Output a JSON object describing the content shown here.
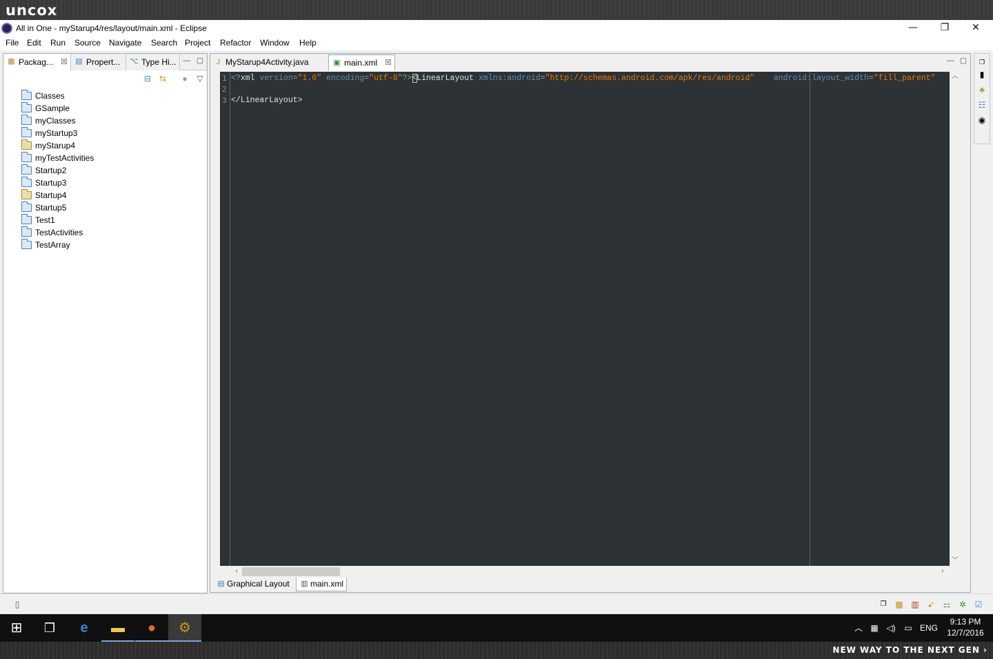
{
  "brand": {
    "logo": "uncox",
    "tagline": "NEW WAY TO THE NEXT GEN ›"
  },
  "window": {
    "title": "All in One - myStarup4/res/layout/main.xml - Eclipse",
    "minimize": "—",
    "restore": "❐",
    "close": "✕"
  },
  "menu": [
    "File",
    "Edit",
    "Run",
    "Source",
    "Navigate",
    "Search",
    "Project",
    "Refactor",
    "Window",
    "Help"
  ],
  "left_tabs": [
    {
      "label": "Packag...",
      "icon": "package-explorer-icon",
      "active": true
    },
    {
      "label": "Propert...",
      "icon": "properties-icon",
      "active": false
    },
    {
      "label": "Type Hi...",
      "icon": "type-hierarchy-icon",
      "active": false
    }
  ],
  "projects": [
    {
      "name": "Classes",
      "type": "java"
    },
    {
      "name": "GSample",
      "type": "java"
    },
    {
      "name": "myClasses",
      "type": "java"
    },
    {
      "name": "myStartup3",
      "type": "java"
    },
    {
      "name": "myStarup4",
      "type": "android"
    },
    {
      "name": "myTestActivities",
      "type": "java"
    },
    {
      "name": "Startup2",
      "type": "java"
    },
    {
      "name": "Startup3",
      "type": "java"
    },
    {
      "name": "Startup4",
      "type": "android"
    },
    {
      "name": "Startup5",
      "type": "java"
    },
    {
      "name": "Test1",
      "type": "java"
    },
    {
      "name": "TestActivities",
      "type": "java"
    },
    {
      "name": "TestArray",
      "type": "java"
    }
  ],
  "editor_tabs": [
    {
      "label": "MyStarup4Activity.java",
      "active": false
    },
    {
      "label": "main.xml",
      "active": true
    }
  ],
  "code": {
    "line_numbers": [
      "1",
      "2",
      "3"
    ],
    "line1": {
      "p1": "<?",
      "t1": "xml",
      "a1": " version",
      "eq1": "=",
      "v1": "\"1.0\"",
      "a2": " encoding",
      "eq2": "=",
      "v2": "\"utf-8\"",
      "p2": "?>",
      "p3": "<",
      "t2": "LinearLayout",
      "a3": " xmlns:android",
      "eq3": "=",
      "v3": "\"http://schemas.android.com/apk/res/android\"",
      "a4": "    android:layout_width",
      "eq4": "=",
      "v4": "\"fill_parent\""
    },
    "line3": "</LinearLayout>"
  },
  "bottom_tabs": [
    {
      "label": "Graphical Layout",
      "active": false
    },
    {
      "label": "main.xml",
      "active": true
    }
  ],
  "taskbar": {
    "language": "ENG",
    "time": "9:13 PM",
    "date": "12/7/2016"
  },
  "colors": {
    "editor_bg": "#2c3235",
    "xml_value": "#ec7600",
    "xml_attr": "#678cb1"
  }
}
